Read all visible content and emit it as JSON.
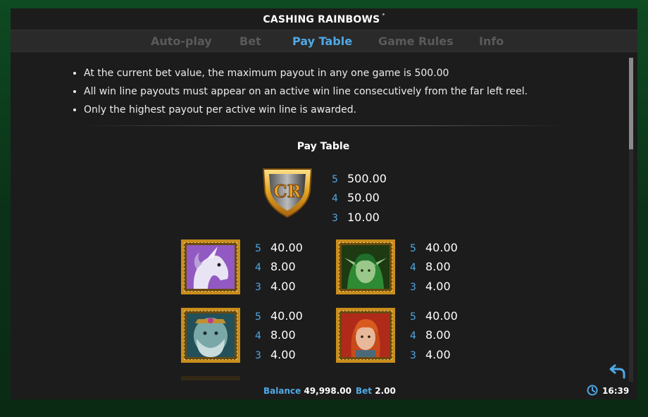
{
  "app": {
    "title": "CASHING RAINBOWS",
    "title_mark": "°"
  },
  "tabs": [
    {
      "label": "Auto-play",
      "active": false
    },
    {
      "label": "Bet",
      "active": false
    },
    {
      "label": "Pay Table",
      "active": true
    },
    {
      "label": "Game Rules",
      "active": false
    },
    {
      "label": "Info",
      "active": false
    }
  ],
  "rules": [
    "At the current bet value, the maximum payout in any one game is 500.00",
    "All win line payouts must appear on an active win line consecutively from the far left reel.",
    "Only the highest payout per active win line is awarded."
  ],
  "paytable": {
    "heading": "Pay Table",
    "top_symbol": {
      "icon": "cr-shield-icon",
      "logo_text": "CR",
      "pays": [
        {
          "count": "5",
          "value": "500.00"
        },
        {
          "count": "4",
          "value": "50.00"
        },
        {
          "count": "3",
          "value": "10.00"
        }
      ]
    },
    "symbols": [
      {
        "icon": "unicorn-icon",
        "pays": [
          {
            "count": "5",
            "value": "40.00"
          },
          {
            "count": "4",
            "value": "8.00"
          },
          {
            "count": "3",
            "value": "4.00"
          }
        ]
      },
      {
        "icon": "elf-icon",
        "pays": [
          {
            "count": "5",
            "value": "40.00"
          },
          {
            "count": "4",
            "value": "8.00"
          },
          {
            "count": "3",
            "value": "4.00"
          }
        ]
      },
      {
        "icon": "wizard-icon",
        "pays": [
          {
            "count": "5",
            "value": "40.00"
          },
          {
            "count": "4",
            "value": "8.00"
          },
          {
            "count": "3",
            "value": "4.00"
          }
        ]
      },
      {
        "icon": "warrior-icon",
        "pays": [
          {
            "count": "5",
            "value": "40.00"
          },
          {
            "count": "4",
            "value": "8.00"
          },
          {
            "count": "3",
            "value": "4.00"
          }
        ]
      }
    ]
  },
  "footer": {
    "balance_label": "Balance",
    "balance_value": "49,998.00",
    "bet_label": "Bet",
    "bet_value": "2.00",
    "clock_icon": "clock-icon",
    "time": "16:39",
    "back_icon": "back-arrow-icon"
  },
  "colors": {
    "accent": "#4fa8e6",
    "tab_inactive": "#5a5a5a",
    "panel": "#1c1c1c",
    "frame_gold": "#c98d1c",
    "background_green": "#0c3a1c"
  }
}
